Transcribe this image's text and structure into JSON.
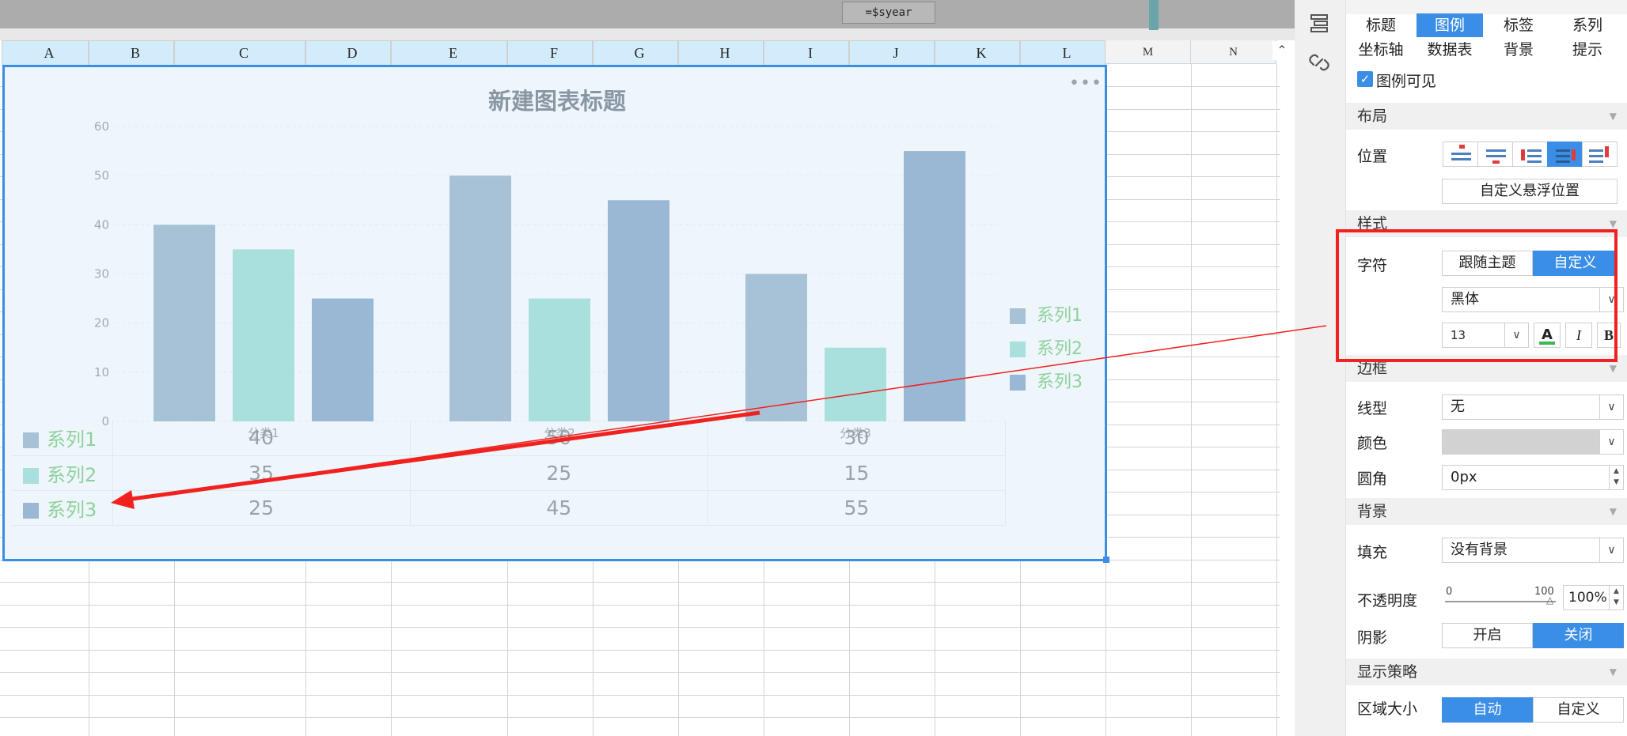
{
  "formula_chip": "=$syear",
  "columns": [
    "A",
    "B",
    "C",
    "D",
    "E",
    "F",
    "G",
    "H",
    "I",
    "J",
    "K",
    "L",
    "M",
    "N"
  ],
  "chart": {
    "more_icon": "ellipsis-icon",
    "data_table": {
      "categories": [
        "分类1",
        "分类2",
        "分类3"
      ],
      "rows": [
        {
          "name": "系列1",
          "values": [
            "40",
            "50",
            "30"
          ]
        },
        {
          "name": "系列2",
          "values": [
            "35",
            "25",
            "15"
          ]
        },
        {
          "name": "系列3",
          "values": [
            "25",
            "45",
            "55"
          ]
        }
      ]
    }
  },
  "chart_data": {
    "type": "bar",
    "title": "新建图表标题",
    "categories": [
      "分类1",
      "分类2",
      "分类3"
    ],
    "series": [
      {
        "name": "系列1",
        "values": [
          40,
          50,
          30
        ],
        "color": "#a7c2d7"
      },
      {
        "name": "系列2",
        "values": [
          35,
          25,
          15
        ],
        "color": "#a9dfdc"
      },
      {
        "name": "系列3",
        "values": [
          25,
          45,
          55
        ],
        "color": "#9ab8d3"
      }
    ],
    "ylim": [
      0,
      60
    ],
    "yticks": [
      0,
      10,
      20,
      30,
      40,
      50,
      60
    ],
    "grid": true,
    "legend": "right",
    "legend_color": "#8fd19c"
  },
  "panel": {
    "tabs_row1": [
      "标题",
      "图例",
      "标签",
      "系列"
    ],
    "tabs_row2": [
      "坐标轴",
      "数据表",
      "背景",
      "提示"
    ],
    "active_tab": "图例",
    "legend_visible_label": "图例可见",
    "legend_visible": true,
    "section_layout": "布局",
    "position_label": "位置",
    "custom_float_btn": "自定义悬浮位置",
    "section_style": "样式",
    "char_label": "字符",
    "follow_theme_btn": "跟随主题",
    "custom_btn": "自定义",
    "font_family": "黑体",
    "font_size": "13",
    "bold_label": "B",
    "italic_label": "I",
    "color_label": "A",
    "section_border": "边框",
    "line_type_label": "线型",
    "line_type_value": "无",
    "color_field_label": "颜色",
    "radius_label": "圆角",
    "radius_value": "0px",
    "section_bg": "背景",
    "fill_label": "填充",
    "fill_value": "没有背景",
    "opacity_label": "不透明度",
    "opacity_min": "0",
    "opacity_max": "100",
    "opacity_value": "100%",
    "shadow_label": "阴影",
    "shadow_on": "开启",
    "shadow_off": "关闭",
    "section_display": "显示策略",
    "area_size_label": "区域大小",
    "area_auto": "自动",
    "area_custom": "自定义",
    "accent_color": "#3a8ee6"
  }
}
